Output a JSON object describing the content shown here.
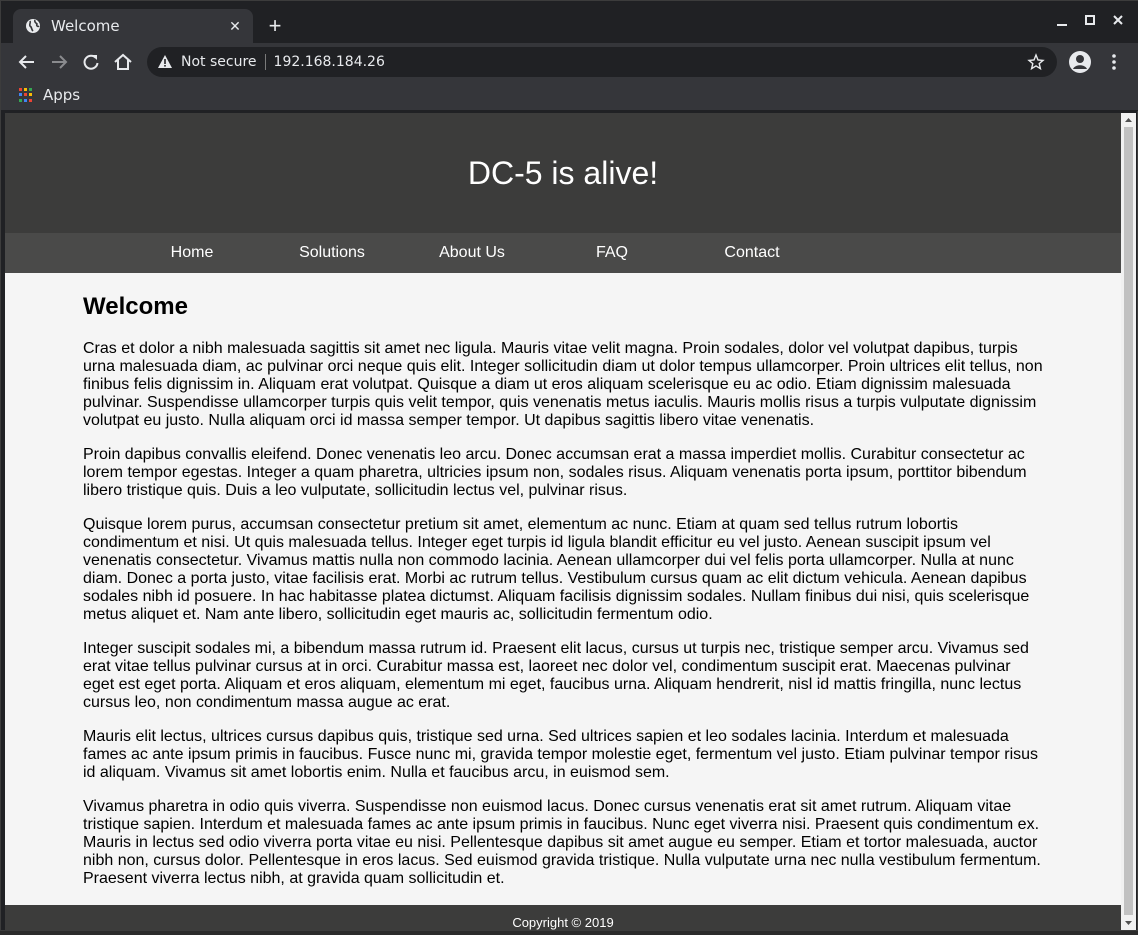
{
  "browser": {
    "tab_title": "Welcome",
    "tab_close": "✕",
    "new_tab": "+",
    "not_secure": "Not secure",
    "url": "192.168.184.26",
    "bookmarks_apps": "Apps",
    "icons": {
      "favicon": "globe-icon",
      "back": "back-arrow-icon",
      "forward": "forward-arrow-icon",
      "reload": "reload-icon",
      "home": "home-icon",
      "warning": "warning-icon",
      "bookmark": "star-icon",
      "profile": "account-icon",
      "menu": "kebab-menu-icon",
      "minimize": "minimize-icon",
      "maximize": "maximize-icon",
      "close": "close-icon"
    }
  },
  "site": {
    "title": "DC-5 is alive!",
    "nav": [
      {
        "label": "Home"
      },
      {
        "label": "Solutions"
      },
      {
        "label": "About Us"
      },
      {
        "label": "FAQ"
      },
      {
        "label": "Contact"
      }
    ],
    "heading": "Welcome",
    "paragraphs": [
      "Cras et dolor a nibh malesuada sagittis sit amet nec ligula. Mauris vitae velit magna. Proin sodales, dolor vel volutpat dapibus, turpis urna malesuada diam, ac pulvinar orci neque quis elit. Integer sollicitudin diam ut dolor tempus ullamcorper. Proin ultrices elit tellus, non finibus felis dignissim in. Aliquam erat volutpat. Quisque a diam ut eros aliquam scelerisque eu ac odio. Etiam dignissim malesuada pulvinar. Suspendisse ullamcorper turpis quis velit tempor, quis venenatis metus iaculis. Mauris mollis risus a turpis vulputate dignissim volutpat eu justo. Nulla aliquam orci id massa semper tempor. Ut dapibus sagittis libero vitae venenatis.",
      "Proin dapibus convallis eleifend. Donec venenatis leo arcu. Donec accumsan erat a massa imperdiet mollis. Curabitur consectetur ac lorem tempor egestas. Integer a quam pharetra, ultricies ipsum non, sodales risus. Aliquam venenatis porta ipsum, porttitor bibendum libero tristique quis. Duis a leo vulputate, sollicitudin lectus vel, pulvinar risus.",
      "Quisque lorem purus, accumsan consectetur pretium sit amet, elementum ac nunc. Etiam at quam sed tellus rutrum lobortis condimentum et nisi. Ut quis malesuada tellus. Integer eget turpis id ligula blandit efficitur eu vel justo. Aenean suscipit ipsum vel venenatis consectetur. Vivamus mattis nulla non commodo lacinia. Aenean ullamcorper dui vel felis porta ullamcorper. Nulla at nunc diam. Donec a porta justo, vitae facilisis erat. Morbi ac rutrum tellus. Vestibulum cursus quam ac elit dictum vehicula. Aenean dapibus sodales nibh id posuere. In hac habitasse platea dictumst. Aliquam facilisis dignissim sodales. Nullam finibus dui nisi, quis scelerisque metus aliquet et. Nam ante libero, sollicitudin eget mauris ac, sollicitudin fermentum odio.",
      "Integer suscipit sodales mi, a bibendum massa rutrum id. Praesent elit lacus, cursus ut turpis nec, tristique semper arcu. Vivamus sed erat vitae tellus pulvinar cursus at in orci. Curabitur massa est, laoreet nec dolor vel, condimentum suscipit erat. Maecenas pulvinar eget est eget porta. Aliquam et eros aliquam, elementum mi eget, faucibus urna. Aliquam hendrerit, nisl id mattis fringilla, nunc lectus cursus leo, non condimentum massa augue ac erat.",
      "Mauris elit lectus, ultrices cursus dapibus quis, tristique sed urna. Sed ultrices sapien et leo sodales lacinia. Interdum et malesuada fames ac ante ipsum primis in faucibus. Fusce nunc mi, gravida tempor molestie eget, fermentum vel justo. Etiam pulvinar tempor risus id aliquam. Vivamus sit amet lobortis enim. Nulla et faucibus arcu, in euismod sem.",
      "Vivamus pharetra in odio quis viverra. Suspendisse non euismod lacus. Donec cursus venenatis erat sit amet rutrum. Aliquam vitae tristique sapien. Interdum et malesuada fames ac ante ipsum primis in faucibus. Nunc eget viverra nisi. Praesent quis condimentum ex. Mauris in lectus sed odio viverra porta vitae eu nisi. Pellentesque dapibus sit amet augue eu semper. Etiam et tortor malesuada, auctor nibh non, cursus dolor. Pellentesque in eros lacus. Sed euismod gravida tristique. Nulla vulputate urna nec nulla vestibulum fermentum. Praesent viverra lectus nibh, at gravida quam sollicitudin et."
    ],
    "footer": "Copyright © 2019"
  },
  "colors": {
    "browser_frame": "#202124",
    "toolbar": "#35363a",
    "site_header": "#3c3c3b",
    "site_nav": "#4a4a49",
    "page_bg": "#f5f5f5"
  }
}
